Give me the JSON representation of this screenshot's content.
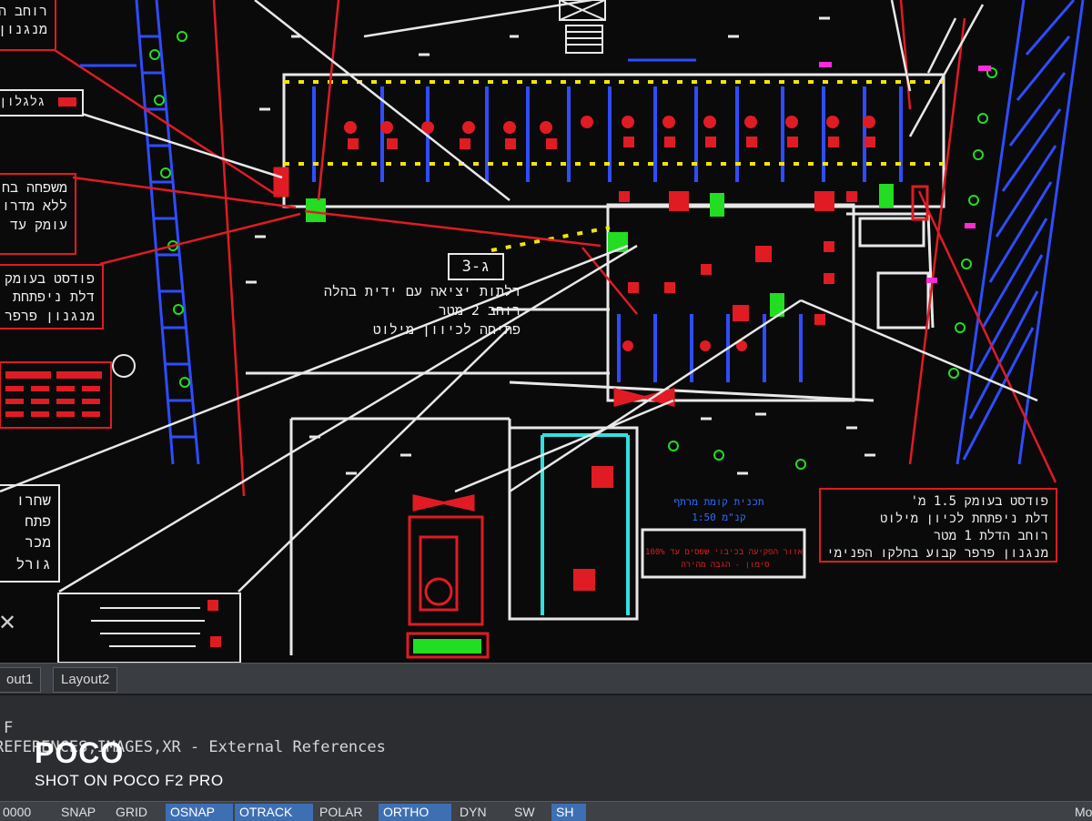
{
  "drawing": {
    "label_c3": "ג-3",
    "center_note": [
      "דלתות יציאה עם ידית בהלה",
      "רוחב 2 מטר",
      "פתיחה לכיוון מילוט"
    ],
    "right_box": [
      "פודסט בעומק 1.5 מ'",
      "דלת ניפתחת לכיון מילוט",
      "רוחב הדלת 1 מטר",
      "מנגנון פרפר קבוע בחלקו הפנימי"
    ],
    "left_box_top": [
      "רוחב ה",
      "מנגנון"
    ],
    "left_label_red": "גלגלון",
    "left_box_mid": [
      "משפחה בח",
      "ללא מדרו",
      "עומק עד"
    ],
    "left_box_low": [
      "פודסט בעומק",
      "דלת ניפתחת",
      "מנגנון פרפר ק"
    ],
    "left_box_bottom": [
      "שחרו",
      "פתח",
      "מכר",
      "גורל"
    ],
    "bottom_box_text": [
      "אזור הפקיעה בכיבוי שפסים עד 100%",
      "סימון - הגבה מהירה"
    ],
    "roof_text": [
      "תכנית קומת מרתף",
      "קנ\"מ 1:50"
    ]
  },
  "tabs": [
    {
      "label": "out1"
    },
    {
      "label": "Layout2"
    }
  ],
  "command_line": [
    "F",
    "REFERENCES,IMAGES,XR - External References"
  ],
  "watermark": {
    "logo": "POCO",
    "subtitle": "SHOT ON POCO F2 PRO"
  },
  "status_bar": {
    "coords": "0000",
    "buttons": [
      {
        "label": "SNAP",
        "on": false
      },
      {
        "label": "GRID",
        "on": false
      },
      {
        "label": "OSNAP",
        "on": true
      },
      {
        "label": "OTRACK",
        "on": true
      },
      {
        "label": "POLAR",
        "on": false
      },
      {
        "label": "ORTHO",
        "on": true
      },
      {
        "label": "DYN",
        "on": false
      },
      {
        "label": "SW",
        "on": false
      },
      {
        "label": "SH",
        "on": true
      }
    ],
    "right_label": "Mo"
  },
  "colors": {
    "background": "#0a0a0a",
    "red": "#e01b24",
    "white": "#e8e8e8",
    "blue": "#2f4cff",
    "yellow": "#f2e600",
    "green": "#22dd22",
    "cyan": "#30e0e0",
    "tab_active_blue": "#3f6fb3"
  }
}
